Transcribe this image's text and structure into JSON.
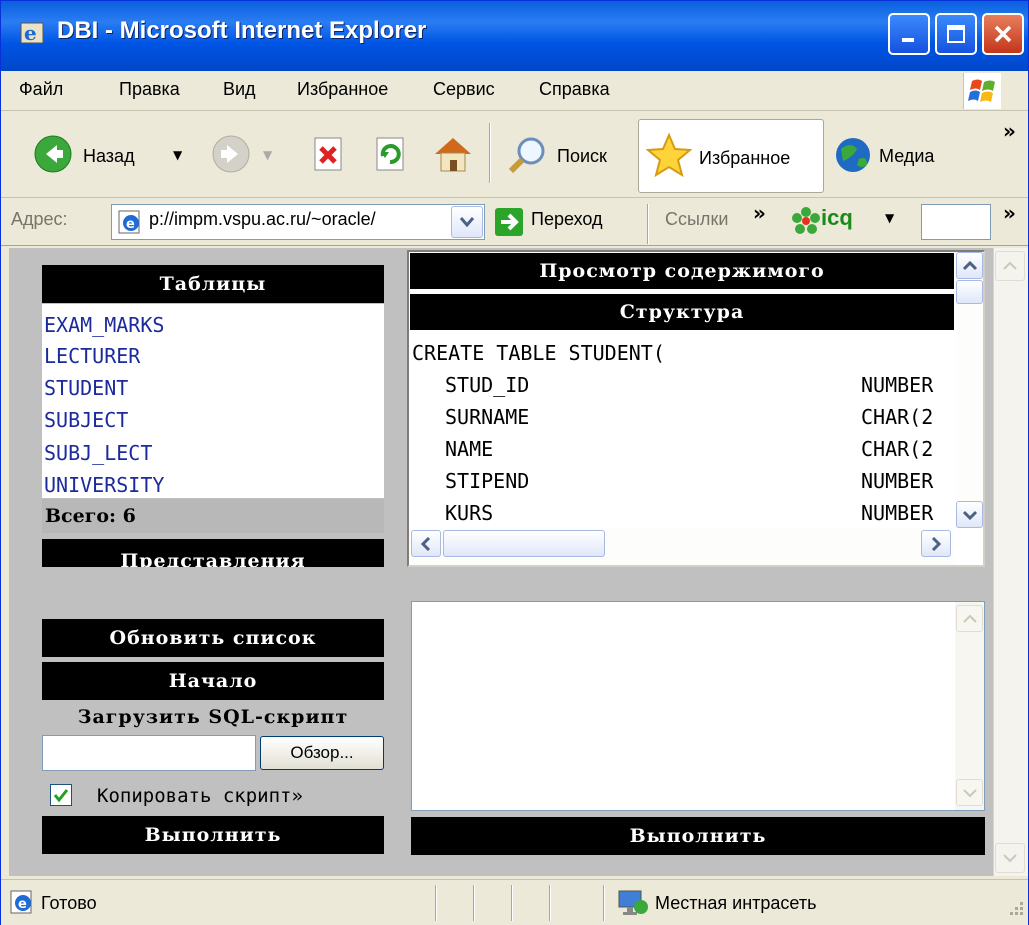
{
  "window": {
    "title": "DBI - Microsoft Internet Explorer"
  },
  "menu": [
    "Файл",
    "Правка",
    "Вид",
    "Избранное",
    "Сервис",
    "Справка"
  ],
  "toolbar": {
    "back_label": "Назад",
    "search_label": "Поиск",
    "favorites_label": "Избранное",
    "media_label": "Медиа",
    "more_glyph": "»"
  },
  "address": {
    "label": "Адрес:",
    "url": "p://impm.vspu.ac.ru/~oracle/",
    "go_label": "Переход",
    "links_label": "Ссылки",
    "icq_label": "icq"
  },
  "left_panel": {
    "tables_header": "Таблицы",
    "tables": [
      "EXAM_MARKS",
      "LECTURER",
      "STUDENT",
      "SUBJECT",
      "SUBJ_LECT",
      "UNIVERSITY"
    ],
    "total_label": "Всего: 6",
    "views_header": "Представления",
    "refresh_label": "Обновить список",
    "home_label": "Начало",
    "load_script_label": "Загрузить SQL-скрипт",
    "browse_label": "Обзор...",
    "copy_script_label": "Копировать скрипт»",
    "copy_script_checked": true,
    "execute_label": "Выполнить"
  },
  "right_panel": {
    "view_header": "Просмотр содержимого",
    "structure_header": "Структура",
    "create_line": "CREATE TABLE STUDENT(",
    "columns": [
      {
        "name": "STUD_ID",
        "type": "NUMBER"
      },
      {
        "name": "SURNAME",
        "type": "CHAR(2"
      },
      {
        "name": "NAME",
        "type": "CHAR(2"
      },
      {
        "name": "STIPEND",
        "type": "NUMBER"
      },
      {
        "name": "KURS",
        "type": "NUMBER"
      }
    ],
    "execute_label": "Выполнить"
  },
  "status": {
    "text": "Готово",
    "zone": "Местная интрасеть"
  }
}
